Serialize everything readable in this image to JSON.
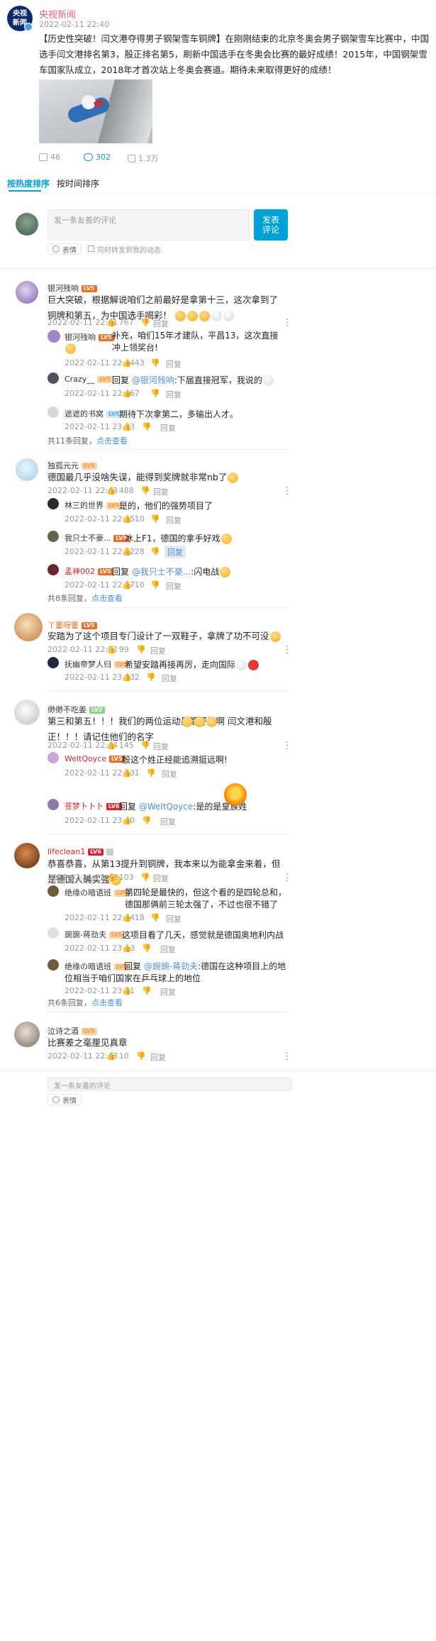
{
  "post": {
    "author": "央视新闻",
    "avatar_text": "央视\n新闻",
    "time": "2022-02-11 22:40",
    "text": "【历史性突破！闫文港夺得男子钢架雪车铜牌】在刚刚结束的北京冬奥会男子钢架雪车比赛中，中国选手闫文港排名第3，殷正排名第5，刷新中国选手在冬奥会比赛的最好成绩！2015年，中国钢架雪车国家队成立，2018年才首次站上冬奥会赛道。期待未来取得更好的成绩！",
    "shares": "46",
    "comments": "302",
    "likes": "1.3万"
  },
  "tabs": {
    "hot": "按热度排序",
    "time": "按时间排序"
  },
  "compose": {
    "placeholder": "发一条友善的评论",
    "submit": "发表\n评论",
    "emoji": "表情",
    "repost": "同时转发到我的动态"
  },
  "comments": [
    {
      "user": "银河残响",
      "level": "LV5",
      "text": "巨大突破，根据解说咱们之前最好是拿第十三，这次拿到了铜牌和第五，为中国选手喝彩！",
      "time": "2022-02-11 22:41",
      "likes": "767",
      "reply_label": "回复",
      "replies": [
        {
          "user": "银河残响",
          "level": "LV5",
          "text": "补充，咱们15年才建队，平昌13，这次直接冲上领奖台!",
          "time": "2022-02-11 22:44",
          "likes": "43",
          "reply_label": "回复"
        },
        {
          "user": "Crazy__",
          "level": "LV5",
          "prefix": "回复 ",
          "at": "@银河残响",
          "text": ":下届直接冠军，我说的",
          "time": "2022-02-11 22:46",
          "likes": "7",
          "reply_label": "回复"
        },
        {
          "user": "遮遮的书窝",
          "level": "LV5",
          "text": "期待下次拿第二，多输出人才。",
          "time": "2022-02-11 23:23",
          "likes": "",
          "reply_label": "回复"
        }
      ],
      "more_count": "共11条回复，",
      "more_link": "点击查看"
    },
    {
      "user": "独孤元元",
      "level": "LV5",
      "text": "德国最几乎没啥失误，能得到奖牌就非常nb了",
      "time": "2022-02-11 22:43",
      "likes": "488",
      "reply_label": "回复",
      "replies": [
        {
          "user": "林三的世界",
          "level": "LV5",
          "text": "是的，他们的强势项目了",
          "time": "2022-02-11 22:45",
          "likes": "10",
          "reply_label": "回复"
        },
        {
          "user": "我只士不豪...",
          "level": "LV5",
          "text": "冰上F1，德国的拿手好戏",
          "time": "2022-02-11 22:52",
          "likes": "28",
          "reply_label": "回复"
        },
        {
          "user": "孟神002",
          "level": "LV5",
          "prefix": "回复 ",
          "at": "@我只士不豪...",
          "text": ":闪电战",
          "time": "2022-02-11 22:57",
          "likes": "10",
          "reply_label": "回复"
        }
      ],
      "more_count": "共8条回复，",
      "more_link": "点击查看"
    },
    {
      "user": "丫董呀董",
      "level": "LV5",
      "text": "安踏为了这个项目专门设计了一双鞋子，拿牌了功不可没",
      "time": "2022-02-11 22:52",
      "likes": "99",
      "reply_label": "回复",
      "replies": [
        {
          "user": "抚幽帝梦人归",
          "level": "LV5",
          "text": "希望安踏再接再厉，走向国际",
          "time": "2022-02-11 23:23",
          "likes": "2",
          "reply_label": "回复"
        }
      ]
    },
    {
      "user": "缈缈不吃姜",
      "level": "LV2",
      "text": "第三和第五！！！我们的两位运动员都好棒啊 闫文港和殷正！！！请记住他们的名字",
      "time": "2022-02-11 22:44",
      "likes": "145",
      "reply_label": "回复",
      "replies": [
        {
          "user": "WeltQoyce",
          "level": "LV5",
          "text": "殷这个姓正经能追溯挺远啊!",
          "time": "2022-02-11 22:53",
          "likes": "1",
          "reply_label": "回复"
        },
        {
          "user": "苍梦卜卜卜",
          "level": "LV6",
          "prefix": "回复 ",
          "at": "@WeltQoyce",
          "text": ":是的是皇族姓",
          "time": "2022-02-11 23:40",
          "likes": "",
          "reply_label": "回复"
        }
      ]
    },
    {
      "user": "lifeclean1",
      "level": "LV6",
      "text": "恭喜恭喜，从第13提升到铜牌，我本来以为能拿金来着，但是德国人确实强",
      "time": "2022-02-11 22:42",
      "likes": "103",
      "reply_label": "回复",
      "replies": [
        {
          "user": "绝缘の暗语班",
          "level": "LV5",
          "text": "第四轮是最快的，但这个看的是四轮总和，德国那俩前三轮太强了，不过也很不错了",
          "time": "2022-02-11 22:44",
          "likes": "18",
          "reply_label": "回复"
        },
        {
          "user": "豌豌-蒋劲夫",
          "level": "LV5",
          "text": "这项目看了几天，感觉就是德国奥地利内战",
          "time": "2022-02-11 23:13",
          "likes": "",
          "reply_label": "回复"
        },
        {
          "user": "绝缘の暗语班",
          "level": "LV5",
          "prefix": "回复 ",
          "at": "@豌豌-蒋劲夫",
          "text": ":德国在这种项目上的地位相当于咱们国家在乒乓球上的地位",
          "time": "2022-02-11 23:21",
          "likes": "",
          "reply_label": "回复"
        }
      ],
      "more_count": "共6条回复，",
      "more_link": "点击查看"
    },
    {
      "user": "泣诗之酒",
      "level": "LV5",
      "text": "比赛差之毫厘见真章",
      "time": "2022-02-11 22:43",
      "likes": "10",
      "reply_label": "回复",
      "replies": []
    }
  ],
  "bottom_compose": {
    "placeholder": "发一条友善的评论",
    "emoji": "表情"
  },
  "colors": {
    "accent": "#00a1d6",
    "name_red": "#e2232a",
    "link": "#4a90d9"
  }
}
